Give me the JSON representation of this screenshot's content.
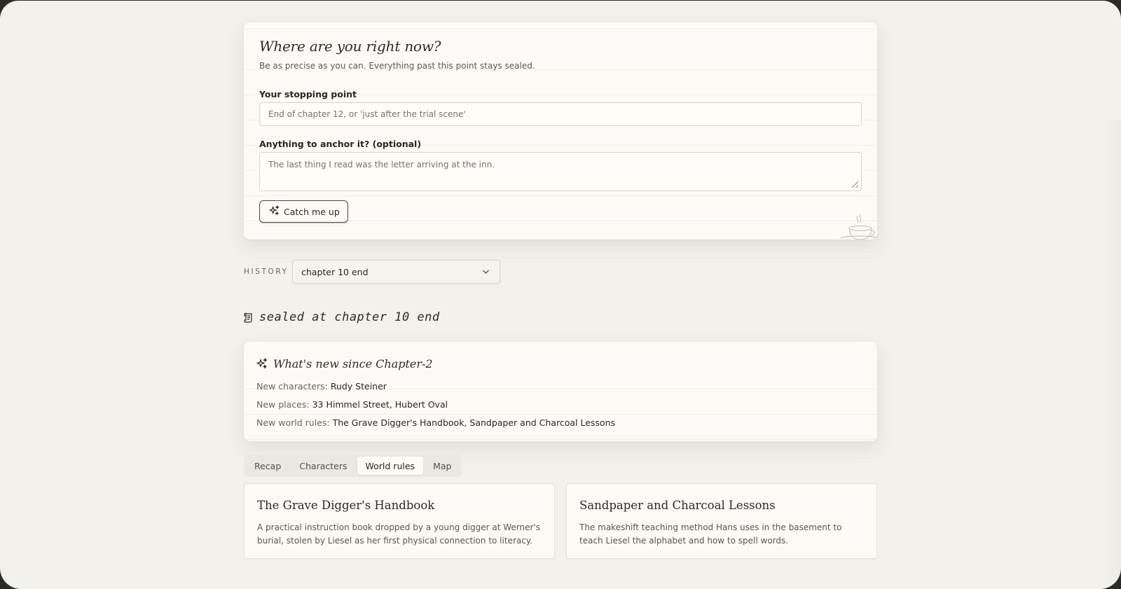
{
  "question_card": {
    "title": "Where are you right now?",
    "subtitle": "Be as precise as you can. Everything past this point stays sealed.",
    "stopping_label": "Your stopping point",
    "stopping_placeholder": "End of chapter 12, or 'just after the trial scene'",
    "anchor_label": "Anything to anchor it? (optional)",
    "anchor_placeholder": "The last thing I read was the letter arriving at the inn.",
    "button_label": "Catch me up"
  },
  "history": {
    "label": "HISTORY",
    "selected": "chapter 10 end"
  },
  "sealed": {
    "text": "sealed at chapter 10 end"
  },
  "whats_new": {
    "title": "What's new since Chapter-2",
    "lines": [
      {
        "key": "New characters:",
        "value": "Rudy Steiner"
      },
      {
        "key": "New places:",
        "value": "33 Himmel Street, Hubert Oval"
      },
      {
        "key": "New world rules:",
        "value": "The Grave Digger's Handbook, Sandpaper and Charcoal Lessons"
      }
    ]
  },
  "tabs": [
    {
      "label": "Recap",
      "active": false
    },
    {
      "label": "Characters",
      "active": false
    },
    {
      "label": "World rules",
      "active": true
    },
    {
      "label": "Map",
      "active": false
    }
  ],
  "rules": [
    {
      "title": "The Grave Digger's Handbook",
      "description": "A practical instruction book dropped by a young digger at Werner's burial, stolen by Liesel as her first physical connection to literacy."
    },
    {
      "title": "Sandpaper and Charcoal Lessons",
      "description": "The makeshift teaching method Hans uses in the basement to teach Liesel the alphabet and how to spell words."
    }
  ],
  "icons": {
    "button": "sparkles-icon",
    "history": "chevron-down-icon",
    "sealed": "scroll-icon",
    "whats_new": "sparkles-icon",
    "decoration": "coffee-cup-icon"
  }
}
